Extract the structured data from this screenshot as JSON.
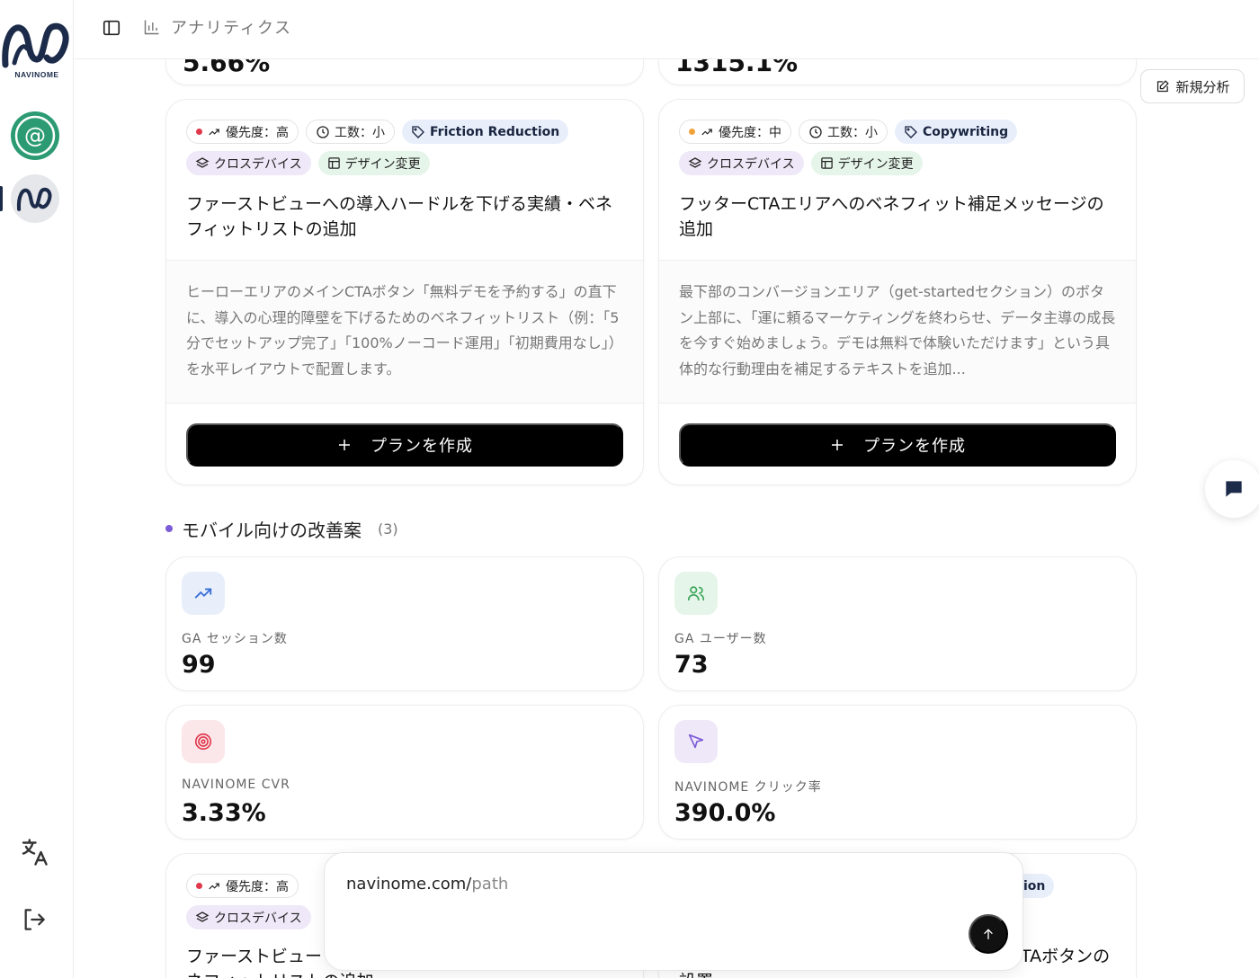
{
  "brand": {
    "name": "NAVINOME"
  },
  "header": {
    "title": "アナリティクス"
  },
  "new_analysis": {
    "label": "新規分析"
  },
  "top_stubs": [
    {
      "value": "5.66%"
    },
    {
      "value": "1315.1%"
    }
  ],
  "recommendations": [
    {
      "priority": "優先度：高",
      "priority_color": "#e0384b",
      "effort": "工数：小",
      "category": "Friction Reduction",
      "device": "クロスデバイス",
      "type": "デザイン変更",
      "title": "ファーストビューへの導入ハードルを下げる実績・ベネフィットリストの追加",
      "description": "ヒーローエリアのメインCTAボタン「無料デモを予約する」の直下に、導入の心理的障壁を下げるためのベネフィットリスト（例：「5分でセットアップ完了」「100%ノーコード運用」「初期費用なし」）を水平レイアウトで配置します。",
      "button": "プランを作成"
    },
    {
      "priority": "優先度：中",
      "priority_color": "#f0a23a",
      "effort": "工数：小",
      "category": "Copywriting",
      "device": "クロスデバイス",
      "type": "デザイン変更",
      "title": "フッターCTAエリアへのベネフィット補足メッセージの追加",
      "description": "最下部のコンバージョンエリア（get-startedセクション）のボタン上部に、「運に頼るマーケティングを終わらせ、データ主導の成長を今すぐ始めましょう。デモは無料で体験いただけます」という具体的な行動理由を補足するテキストを追加...",
      "button": "プランを作成"
    }
  ],
  "mobile_section": {
    "title": "モバイル向けの改善案",
    "count": "(3)"
  },
  "metrics": [
    {
      "label": "GA セッション数",
      "value": "99",
      "icon": "trending-up-icon",
      "bg": "#e8effb",
      "color": "#3b6fd8"
    },
    {
      "label": "GA ユーザー数",
      "value": "73",
      "icon": "users-icon",
      "bg": "#e6f5ea",
      "color": "#3aa55a"
    },
    {
      "label": "NAVINOME CVR",
      "value": "3.33%",
      "icon": "target-icon",
      "bg": "#fbe7ea",
      "color": "#e0384b"
    },
    {
      "label": "NAVINOME クリック率",
      "value": "390.0%",
      "icon": "pointer-icon",
      "bg": "#efe8f8",
      "color": "#7c5bd8"
    }
  ],
  "bottom_cards": [
    {
      "priority": "優先度：高",
      "priority_color": "#e0384b",
      "device": "クロスデバイス",
      "title_visible": "ファーストビュー",
      "title_line2": "ネフィットリストの追加"
    },
    {
      "tag_fragment": "ction",
      "title_fragment": "TAボタンの",
      "title_line2": "設置"
    }
  ],
  "composer": {
    "url_prefix": "navinome.com/",
    "url_placeholder": "path"
  }
}
